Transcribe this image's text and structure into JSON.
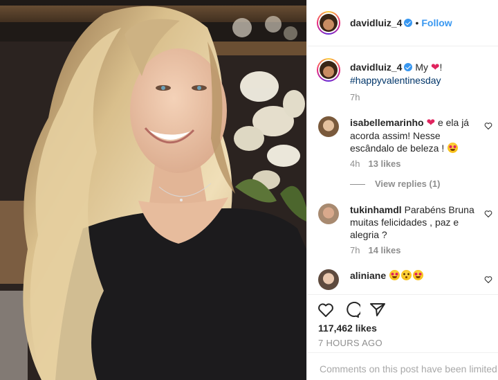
{
  "header": {
    "username": "davidluiz_4",
    "separator": "•",
    "follow_label": "Follow"
  },
  "caption": {
    "username": "davidluiz_4",
    "text_before": "My",
    "text_after": "!",
    "hashtag": "#happyvalentinesday",
    "time": "7h"
  },
  "comments": [
    {
      "username": "isabellemarinho",
      "text": "e ela já acorda assim! Nesse escândalo de beleza !",
      "time": "4h",
      "likes": "13 likes"
    },
    {
      "username": "tukinhamdl",
      "text": "Parabéns Bruna muitas felicidades , paz e alegria ?",
      "time": "7h",
      "likes": "14 likes"
    },
    {
      "username": "aliniane",
      "text": ""
    }
  ],
  "view_replies": "View replies (1)",
  "likes_count": "117,462 likes",
  "timestamp": "7 HOURS AGO",
  "comments_disabled": "Comments on this post have been limited",
  "icons": {
    "verified": "verified-badge-icon",
    "like": "heart-outline-icon",
    "comment": "comment-bubble-icon",
    "share": "paper-plane-icon",
    "comment_like": "small-heart-icon"
  },
  "colors": {
    "accent": "#3897f0",
    "hashtag": "#003569",
    "muted": "#8e8e8e",
    "heart": "#e0245e"
  }
}
